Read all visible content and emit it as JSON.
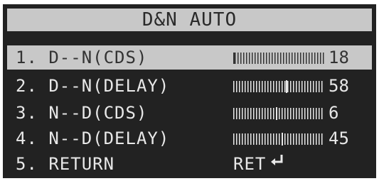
{
  "menu": {
    "title": "D&N AUTO",
    "items": [
      {
        "label": "1. D--N(CDS)",
        "value": "18",
        "level": 18,
        "selected": true
      },
      {
        "label": "2. D--N(DELAY)",
        "value": "58",
        "level": 58,
        "selected": false
      },
      {
        "label": "3. N--D(CDS)",
        "value": "6",
        "level": 6,
        "selected": false
      },
      {
        "label": "4. N--D(DELAY)",
        "value": "45",
        "level": 45,
        "selected": false
      },
      {
        "label": "5. RETURN",
        "value": "RET",
        "icon": "return-arrow-icon",
        "selected": false
      }
    ]
  },
  "colors": {
    "background": "#222222",
    "highlight": "#c8c8c8",
    "text": "#e8e8e8"
  }
}
